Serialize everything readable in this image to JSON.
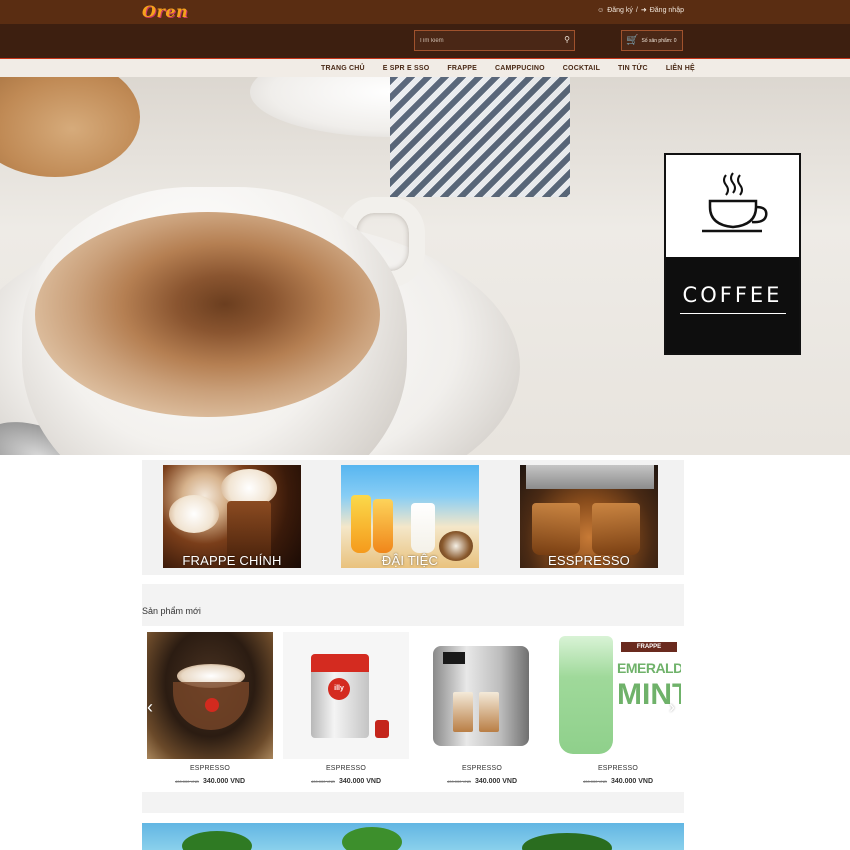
{
  "header": {
    "logo": "Oren",
    "register": "Đăng ký",
    "separator": "/",
    "login": "Đăng nhập"
  },
  "search": {
    "placeholder": "Tìm kiếm"
  },
  "cart": {
    "label": "Số sản phẩm: 0"
  },
  "nav": {
    "items": [
      {
        "label": "TRANG CHỦ"
      },
      {
        "label": "E SPR E SSO"
      },
      {
        "label": "FRAPPE"
      },
      {
        "label": "CAMPPUCINO"
      },
      {
        "label": "COCKTAIL"
      },
      {
        "label": "TIN TỨC"
      },
      {
        "label": "LIÊN HỆ"
      }
    ]
  },
  "hero": {
    "badge_text": "COFFEE"
  },
  "categories": [
    {
      "label": "FRAPPE CHÍNH"
    },
    {
      "label": "ĐẬI TIỆC"
    },
    {
      "label": "ESSPRESSO"
    }
  ],
  "products": {
    "title": "Sản phẩm mới",
    "items": [
      {
        "name": "ESPRESSO",
        "old_price": "400.000 VND",
        "price": "340.000 VND"
      },
      {
        "name": "ESPRESSO",
        "old_price": "400.000 VND",
        "price": "340.000 VND"
      },
      {
        "name": "ESPRESSO",
        "old_price": "400.000 VND",
        "price": "340.000 VND"
      },
      {
        "name": "ESPRESSO",
        "old_price": "400.000 VND",
        "price": "340.000 VND"
      }
    ],
    "mint_brand": "FRAPPE",
    "mint_line1": "EMERALD",
    "mint_line2": "MINT",
    "illy_brand": "illy"
  },
  "colors": {
    "topbar": "#5a2d12",
    "header": "#3d1f10",
    "nav_bg": "#f1ece6",
    "accent": "#c8361b"
  }
}
